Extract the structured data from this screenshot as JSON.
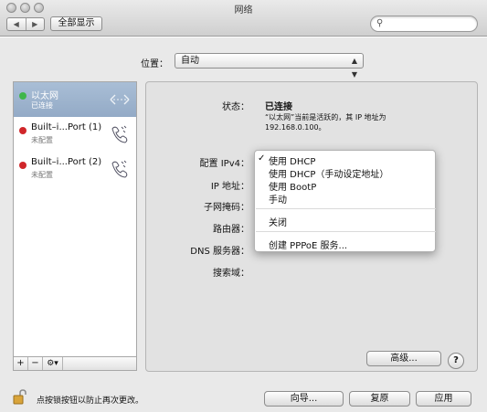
{
  "window": {
    "title": "网络"
  },
  "toolbar": {
    "back": "◀",
    "forward": "▶",
    "show_all": "全部显示",
    "search_placeholder": ""
  },
  "location": {
    "label": "位置：",
    "value": "自动"
  },
  "services": [
    {
      "name": "以太网",
      "status": "已连接",
      "dot_color": "#3fb64a",
      "icon": "ethernet-arrows-icon"
    },
    {
      "name": "Built–i...Port (1)",
      "status": "未配置",
      "dot_color": "#d0262a",
      "icon": "phone-modem-icon"
    },
    {
      "name": "Built–i...Port (2)",
      "status": "未配置",
      "dot_color": "#d0262a",
      "icon": "phone-modem-icon"
    }
  ],
  "list_tools": {
    "add": "+",
    "remove": "−",
    "gear": "⚙▾"
  },
  "detail": {
    "status_label": "状态：",
    "status_value": "已连接",
    "status_desc": "“以太网”当前是活跃的，其 IP 地址为 192.168.0.100。",
    "configure_label": "配置 IPv4：",
    "ip_label": "IP 地址：",
    "subnet_label": "子网掩码：",
    "router_label": "路由器：",
    "dns_label": "DNS 服务器：",
    "search_domain_label": "搜索域：",
    "advanced_button": "高级...",
    "help_button": "?"
  },
  "ipv4_menu": {
    "items": [
      "使用 DHCP",
      "使用 DHCP（手动设定地址）",
      "使用 BootP",
      "手动",
      "关闭",
      "创建 PPPoE 服务..."
    ],
    "checked": "✓"
  },
  "footer": {
    "lock_text": "点按锁按钮以防止再次更改。",
    "assist_button": "向导...",
    "revert_button": "复原",
    "apply_button": "应用"
  },
  "colors": {
    "selection": "#9db3cf",
    "connected": "#3fb64a",
    "not_configured": "#d0262a"
  }
}
